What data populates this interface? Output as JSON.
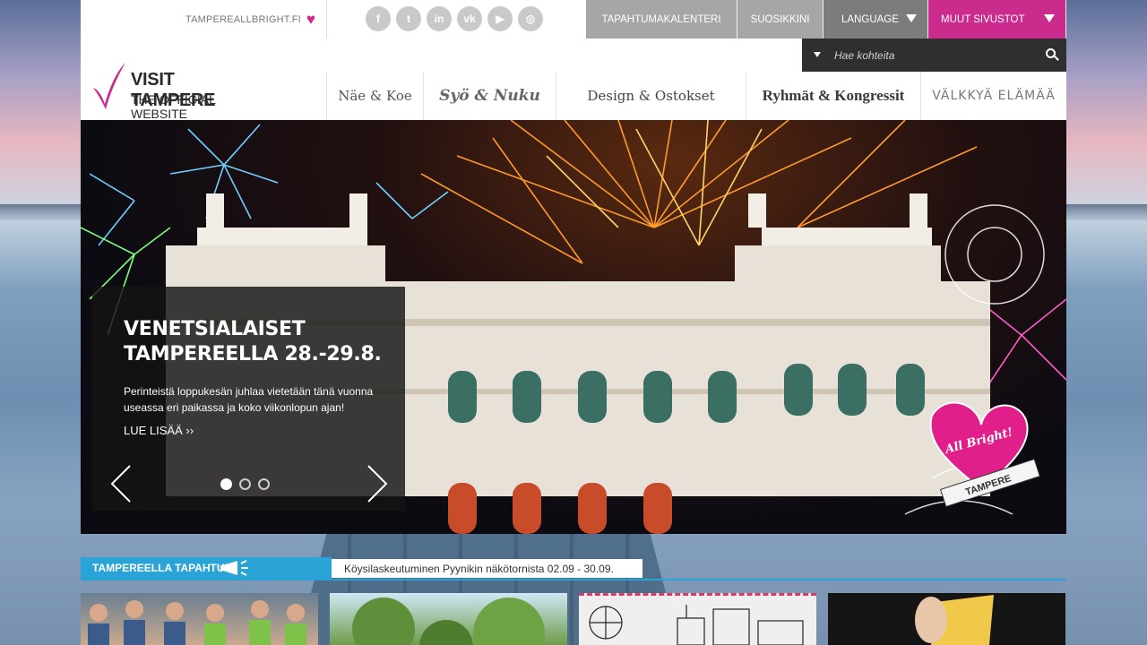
{
  "top": {
    "allbright_link": "TAMPEREALLBRIGHT.FI",
    "socials": [
      {
        "icon": "facebook-icon",
        "glyph": "f"
      },
      {
        "icon": "twitter-icon",
        "glyph": "t"
      },
      {
        "icon": "linkedin-icon",
        "glyph": "in"
      },
      {
        "icon": "vk-icon",
        "glyph": "vk"
      },
      {
        "icon": "youtube-icon",
        "glyph": "▶"
      },
      {
        "icon": "instagram-icon",
        "glyph": "◎"
      }
    ],
    "nav": {
      "calendar": "TAPAHTUMAKALENTERI",
      "favorites": "SUOSIKKINI",
      "language": "LANGUAGE",
      "other_sites": "MUUT SIVUSTOT"
    }
  },
  "search": {
    "placeholder": "Hae kohteita"
  },
  "logo": {
    "title": "VISIT TAMPERE",
    "subtitle": "THE OFFICIAL WEBSITE"
  },
  "main_nav": [
    "Näe & Koe",
    "Syö & Nuku",
    "Design & Ostokset",
    "Ryhmät & Kongressit",
    "VÄLKKYÄ ELÄMÄÄ"
  ],
  "hero": {
    "title": "VENETSIALAISET TAMPEREELLA 28.-29.8.",
    "text": "Perinteistä loppukesän juhlaa vietetään tänä vuonna useassa eri paikassa ja koko viikonlopun ajan!",
    "more": "LUE LISÄÄ ››",
    "slides": 3,
    "active_slide": 1,
    "badge_top": "All Bright!",
    "badge_banner": "TAMPERE"
  },
  "ticker": {
    "label": "TAMPEREELLA TAPAHTUU",
    "message": "Köysilaskeutuminen Pyynikin näkötornista 02.09 - 30.09."
  },
  "colors": {
    "accent_pink": "#cc2b8e",
    "accent_blue": "#2aa3d6",
    "dark": "#2f2f2f"
  }
}
